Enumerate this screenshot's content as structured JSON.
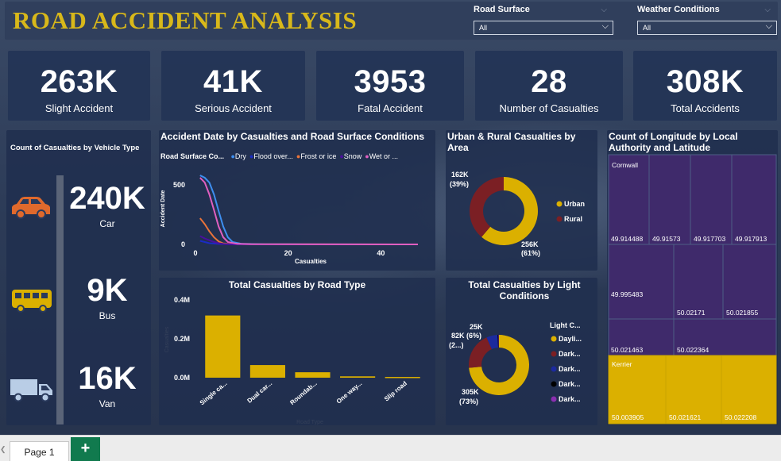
{
  "title": "ROAD ACCIDENT ANALYSIS",
  "slicers": [
    {
      "label": "Road Surface",
      "value": "All"
    },
    {
      "label": "Weather Conditions",
      "value": "All"
    }
  ],
  "kpis": [
    {
      "value": "263K",
      "label": "Slight Accident"
    },
    {
      "value": "41K",
      "label": "Serious Accident"
    },
    {
      "value": "3953",
      "label": "Fatal Accident"
    },
    {
      "value": "28",
      "label": "Number of Casualties"
    },
    {
      "value": "308K",
      "label": "Total Accidents"
    }
  ],
  "vehicles": {
    "title": "Count of Casualties by Vehicle Type",
    "items": [
      {
        "icon": "car-icon",
        "value": "240K",
        "label": "Car"
      },
      {
        "icon": "bus-icon",
        "value": "9K",
        "label": "Bus"
      },
      {
        "icon": "van-icon",
        "value": "16K",
        "label": "Van"
      }
    ]
  },
  "colors": {
    "gold": "#dbb000",
    "dark_red": "#7b1f24",
    "navy": "#1c2a9e",
    "orange_icon": "#e0692c",
    "dry": "#3e8ff0",
    "flood": "#1a2bc4",
    "frost": "#e8733a",
    "snow": "#4a0f9e",
    "wet": "#e05fc0",
    "treemap_purple": "#3f2a6b"
  },
  "chart_data": [
    {
      "type": "line",
      "title": "Accident Date by Casualties and Road Surface Conditions",
      "legend_title": "Road Surface Co...",
      "xlabel": "Casualties",
      "ylabel": "Accident Date",
      "xlim": [
        0,
        48
      ],
      "ylim": [
        0,
        600
      ],
      "xticks": [
        0,
        20,
        40
      ],
      "yticks": [
        0,
        500
      ],
      "series": [
        {
          "name": "Dry",
          "color_key": "dry",
          "x": [
            1,
            2,
            3,
            4,
            5,
            6,
            7,
            8,
            10,
            15,
            20,
            48
          ],
          "y": [
            580,
            560,
            520,
            420,
            280,
            150,
            60,
            20,
            5,
            2,
            1,
            0
          ]
        },
        {
          "name": "Flood over...",
          "color_key": "flood",
          "x": [
            1,
            2,
            3,
            5,
            8,
            48
          ],
          "y": [
            30,
            20,
            10,
            4,
            0,
            0
          ]
        },
        {
          "name": "Frost or ice",
          "color_key": "frost",
          "x": [
            1,
            2,
            3,
            4,
            5,
            6,
            8,
            48
          ],
          "y": [
            220,
            170,
            110,
            60,
            25,
            8,
            2,
            0
          ]
        },
        {
          "name": "Snow",
          "color_key": "snow",
          "x": [
            1,
            2,
            3,
            4,
            5,
            6,
            8,
            48
          ],
          "y": [
            70,
            50,
            35,
            20,
            10,
            4,
            0,
            0
          ]
        },
        {
          "name": "Wet or ...",
          "color_key": "wet",
          "x": [
            1,
            2,
            3,
            4,
            5,
            6,
            7,
            9,
            12,
            48
          ],
          "y": [
            560,
            520,
            420,
            290,
            150,
            60,
            20,
            5,
            1,
            0
          ]
        }
      ]
    },
    {
      "type": "pie",
      "title": "Urban & Rural Casualties by Area",
      "slices": [
        {
          "label": "Urban",
          "value": 256,
          "display": "256K",
          "pct": "(61%)",
          "color_key": "gold"
        },
        {
          "label": "Rural",
          "value": 162,
          "display": "162K",
          "pct": "(39%)",
          "color_key": "dark_red"
        }
      ]
    },
    {
      "type": "bar",
      "title": "Total Casualties by Road Type",
      "xlabel": "Road Type",
      "ylabel": "Casualties",
      "categories": [
        "Single ca...",
        "Dual car...",
        "Roundab...",
        "One way...",
        "Slip road"
      ],
      "values": [
        0.32,
        0.065,
        0.028,
        0.007,
        0.004
      ],
      "ylim": [
        0,
        0.4
      ],
      "yticks": [
        "0.0M",
        "0.2M",
        "0.4M"
      ]
    },
    {
      "type": "pie",
      "title": "Total Casualties by Light Conditions",
      "legend_title": "Light C...",
      "slices": [
        {
          "label": "Dayli...",
          "value": 305,
          "display": "305K",
          "pct": "(73%)",
          "color_key": "gold"
        },
        {
          "label": "Dark...",
          "value": 82,
          "display": "82K (6%)",
          "pct": "(2...)",
          "color_key": "dark_red"
        },
        {
          "label": "Dark...",
          "value": 25,
          "display": "25K",
          "pct": "",
          "color_key": "navy"
        },
        {
          "label": "Dark...",
          "value": 2,
          "display": "",
          "pct": "",
          "color_key": "black"
        },
        {
          "label": "Dark...",
          "value": 1,
          "display": "",
          "pct": "",
          "color_key": "purple"
        }
      ]
    },
    {
      "type": "treemap",
      "title": "Count of Longitude by Local Authority and Latitude",
      "groups": [
        {
          "name": "Cornwall",
          "color_key": "treemap_purple",
          "leaves": [
            "49.914488",
            "49.91573",
            "49.917703",
            "49.917913",
            "49.995483",
            "50.02171",
            "50.021855",
            "50.021463",
            "50.022364"
          ]
        },
        {
          "name": "Kerrier",
          "color_key": "gold",
          "leaves": [
            "50.003905",
            "50.021621",
            "50.022208"
          ]
        }
      ]
    }
  ],
  "tabs": {
    "page": "Page 1",
    "add": "+"
  }
}
